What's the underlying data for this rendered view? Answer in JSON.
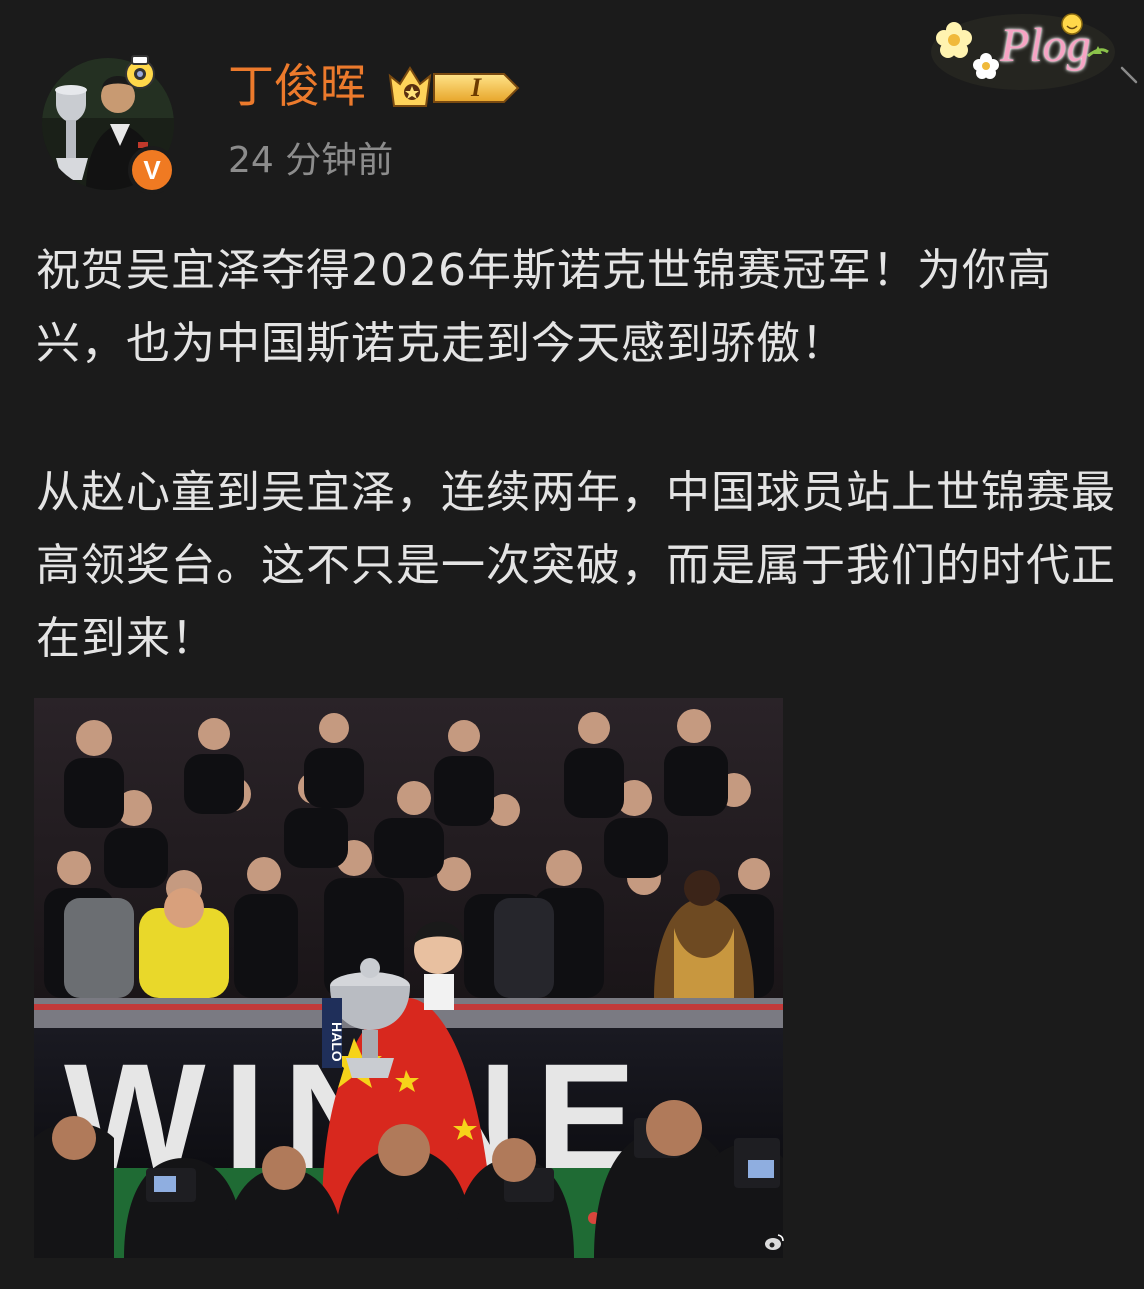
{
  "post": {
    "author": {
      "name": "丁俊晖",
      "verified_badge": "V",
      "vip_level": "I",
      "name_color": "#ec7a2c"
    },
    "timestamp": "24 分钟前",
    "sticker": {
      "text": "Plog",
      "icon": "plog-flower-sticker"
    },
    "paragraphs": [
      "祝贺吴宜泽夺得2026年斯诺克世锦赛冠军！为你高兴，也为中国斯诺克走到今天感到骄傲！",
      "从赵心童到吴宜泽，连续两年，中国球员站上世锦赛最高领奖台。这不只是一次突破，而是属于我们的时代正在到来！"
    ],
    "image": {
      "banner_text": "WINNE",
      "trophy_wrap_text": "HALO",
      "description_icon": "photo-trophy-celebration"
    }
  },
  "colors": {
    "background": "#1b1b1b",
    "text": "#e4e4e4",
    "secondary": "#8c8c8c",
    "accent": "#ec7a2c",
    "flag_red": "#d8281e",
    "flag_yellow": "#f6d31a",
    "table_green": "#1f6b34"
  }
}
